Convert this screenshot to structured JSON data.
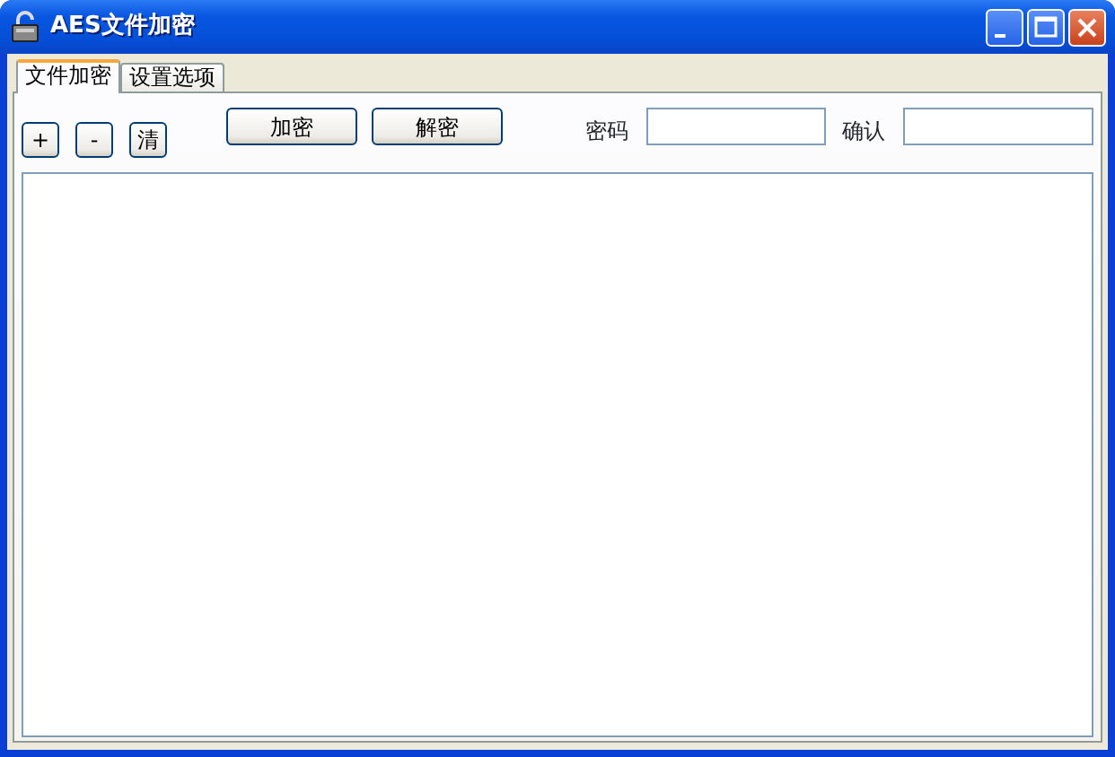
{
  "window": {
    "title": "AES文件加密",
    "controls": [
      {
        "kind": "minimize"
      },
      {
        "kind": "maximize"
      },
      {
        "kind": "close"
      }
    ]
  },
  "tabs": [
    {
      "label": "文件加密",
      "selected": true
    },
    {
      "label": "设置选项",
      "selected": false
    }
  ],
  "list_buttons": [
    "+",
    "-",
    "清"
  ],
  "action_buttons": [
    "加密",
    "解密"
  ],
  "fields": [
    {
      "label": "密码"
    },
    {
      "label": "确认"
    }
  ]
}
